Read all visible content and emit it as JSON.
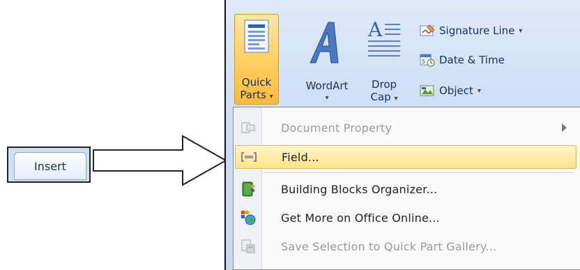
{
  "tab": {
    "label": "Insert"
  },
  "ribbon": {
    "quick_parts": {
      "line1": "Quick",
      "line2": "Parts",
      "caret": "▾"
    },
    "wordart": {
      "label": "WordArt",
      "caret": "▾"
    },
    "drop_cap": {
      "line1": "Drop",
      "line2": "Cap",
      "caret": "▾"
    },
    "signature_line": {
      "label": "Signature Line",
      "caret": "▾"
    },
    "date_time": {
      "label": "Date & Time"
    },
    "object": {
      "label": "Object",
      "caret": "▾"
    }
  },
  "menu": {
    "items": [
      {
        "label": "Document Property",
        "state": "disabled",
        "submenu": true,
        "icon": "document-property-icon"
      },
      {
        "label": "Field...",
        "state": "highlighted",
        "icon": "field-icon"
      },
      {
        "label": "Building Blocks Organizer...",
        "state": "normal",
        "icon": "building-blocks-icon"
      },
      {
        "label": "Get More on Office Online...",
        "state": "normal",
        "icon": "office-online-icon"
      },
      {
        "label": "Save Selection to Quick Part Gallery...",
        "state": "disabled",
        "icon": "save-selection-icon"
      }
    ]
  },
  "colors": {
    "accent": "#ffc85a",
    "ribbon_bg": "#cfdff4",
    "text": "#15325c"
  }
}
